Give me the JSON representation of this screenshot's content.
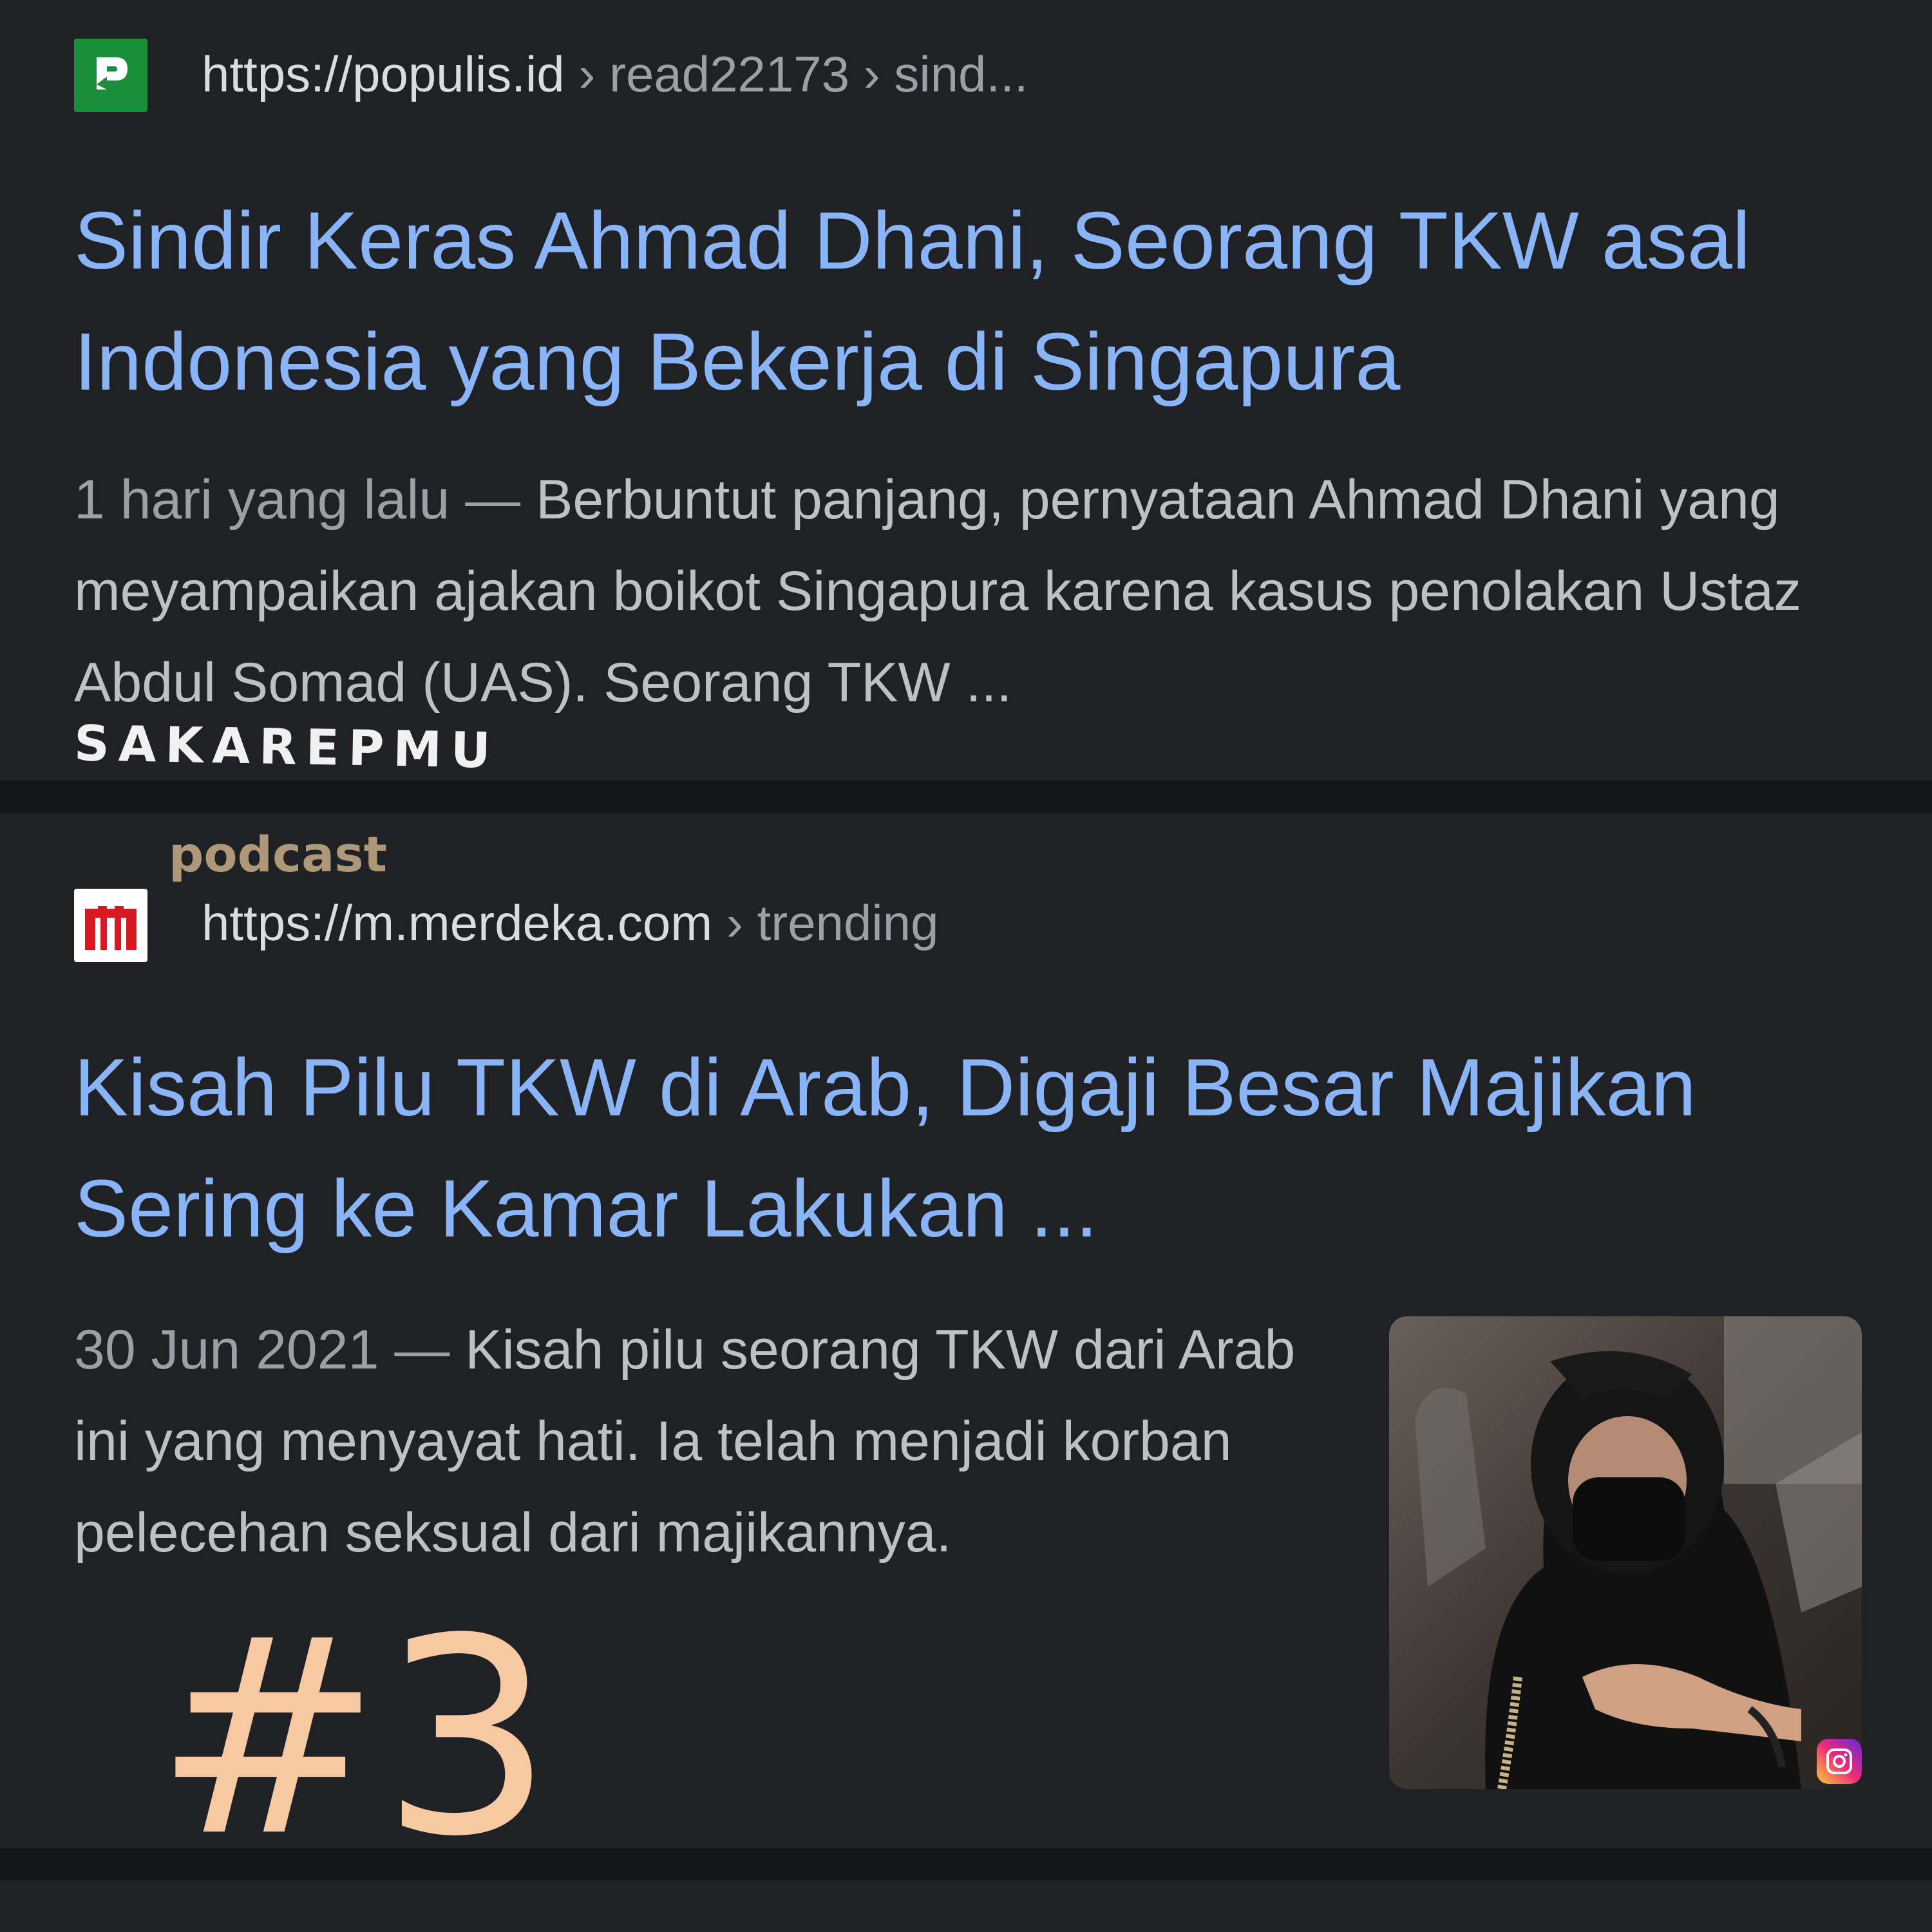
{
  "results": [
    {
      "favicon_icon": "populis-logo-icon",
      "favicon_color": "#1a8f3a",
      "url_base": "https://populis.id",
      "url_crumbs": " › read22173 › sind...",
      "title": "Sindir Keras Ahmad Dhani, Seorang TKW asal Indonesia yang Bekerja di Singapura",
      "date": "1 hari yang lalu — ",
      "snippet": "Berbuntut panjang, pernyataan Ahmad Dhani yang meyampaikan ajakan boikot Singapura karena kasus penolakan Ustaz Abdul Somad (UAS). Seorang TKW ..."
    },
    {
      "favicon_icon": "merdeka-logo-icon",
      "favicon_color": "#d71921",
      "url_base": "https://m.merdeka.com",
      "url_crumbs": " › trending",
      "title": "Kisah Pilu TKW di Arab, Digaji Besar Majikan Sering ke Kamar Lakukan ...",
      "date": "30 Jun 2021 — ",
      "snippet": "Kisah pilu seorang TKW dari Arab ini yang menyayat hati. Ia telah menjadi korban pelecehan seksual dari majikannya.",
      "thumbnail_icon": "instagram-icon"
    }
  ],
  "overlays": {
    "watermark": "SAKAREPMU",
    "podcast": "podcast",
    "number": "#3"
  },
  "colors": {
    "background": "#202124",
    "title_link": "#8ab4f8",
    "snippet_text": "#bdc1c6",
    "overlay_number": "#f7c9a3"
  }
}
